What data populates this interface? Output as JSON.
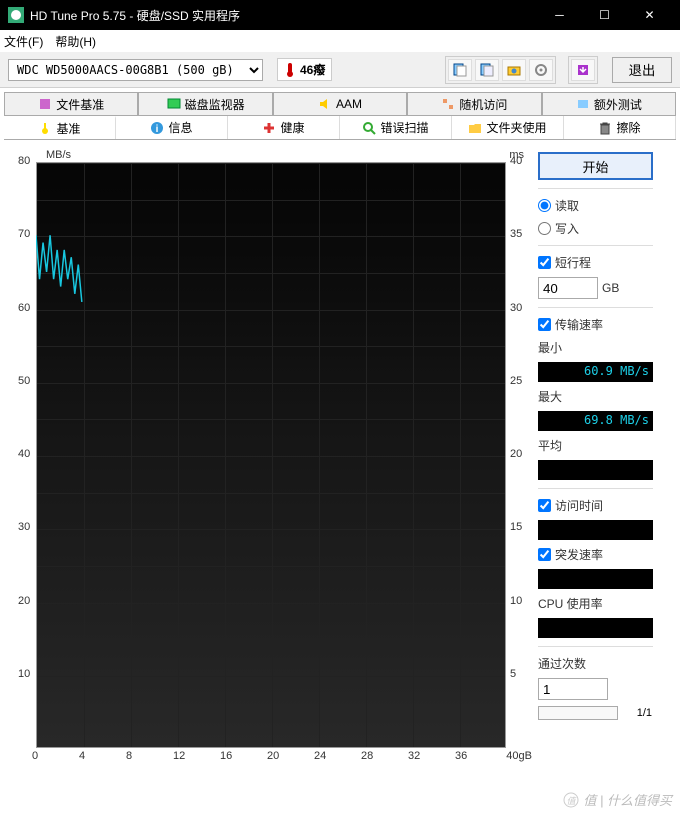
{
  "window": {
    "title": "HD Tune Pro 5.75 - 硬盘/SSD 实用程序"
  },
  "menu": {
    "file": "文件(F)",
    "help": "帮助(H)"
  },
  "toolbar": {
    "drive": "WDC WD5000AACS-00G8B1 (500 gB)",
    "temp": "46癈",
    "exit": "退出"
  },
  "tabs_top": {
    "file_bench": "文件基准",
    "disk_monitor": "磁盘监视器",
    "aam": "AAM",
    "random_access": "随机访问",
    "extra_tests": "额外测试"
  },
  "tabs_bottom": {
    "benchmark": "基准",
    "info": "信息",
    "health": "健康",
    "error_scan": "错误扫描",
    "folder_usage": "文件夹使用",
    "erase": "擦除"
  },
  "chart": {
    "y1_unit": "MB/s",
    "y2_unit": "ms",
    "x_unit": "gB",
    "y1_max": 80,
    "y2_max": 40
  },
  "chart_data": {
    "type": "line",
    "x_range": [
      0,
      40
    ],
    "y1_ticks": [
      80,
      70,
      60,
      50,
      40,
      30,
      20,
      10
    ],
    "y2_ticks": [
      40,
      35,
      30,
      25,
      20,
      15,
      10,
      5
    ],
    "x_ticks": [
      0,
      4,
      8,
      12,
      16,
      20,
      24,
      28,
      32,
      36,
      40
    ],
    "series": [
      {
        "name": "transfer_rate",
        "unit": "MB/s",
        "points": [
          [
            0,
            70
          ],
          [
            0.3,
            64
          ],
          [
            0.6,
            69
          ],
          [
            0.9,
            65
          ],
          [
            1.2,
            70
          ],
          [
            1.5,
            64
          ],
          [
            1.8,
            68
          ],
          [
            2.1,
            63
          ],
          [
            2.4,
            68
          ],
          [
            2.7,
            64
          ],
          [
            3.0,
            67
          ],
          [
            3.3,
            62
          ],
          [
            3.6,
            66
          ],
          [
            3.9,
            60.9
          ]
        ]
      }
    ],
    "title": "",
    "xlabel": "gB",
    "ylabel_left": "MB/s",
    "ylabel_right": "ms"
  },
  "side": {
    "start": "开始",
    "read": "读取",
    "write": "写入",
    "short_stroke": "短行程",
    "short_stroke_val": "40",
    "short_stroke_unit": "GB",
    "transfer_rate": "传输速率",
    "min": "最小",
    "min_val": "60.9 MB/s",
    "max": "最大",
    "max_val": "69.8 MB/s",
    "avg": "平均",
    "avg_val": "",
    "access_time": "访问时间",
    "access_val": "",
    "burst_rate": "突发速率",
    "burst_val": "",
    "cpu_usage": "CPU 使用率",
    "cpu_val": "",
    "passes": "通过次数",
    "passes_val": "1",
    "pass_count": "1/1"
  },
  "watermark": "值 | 什么值得买"
}
